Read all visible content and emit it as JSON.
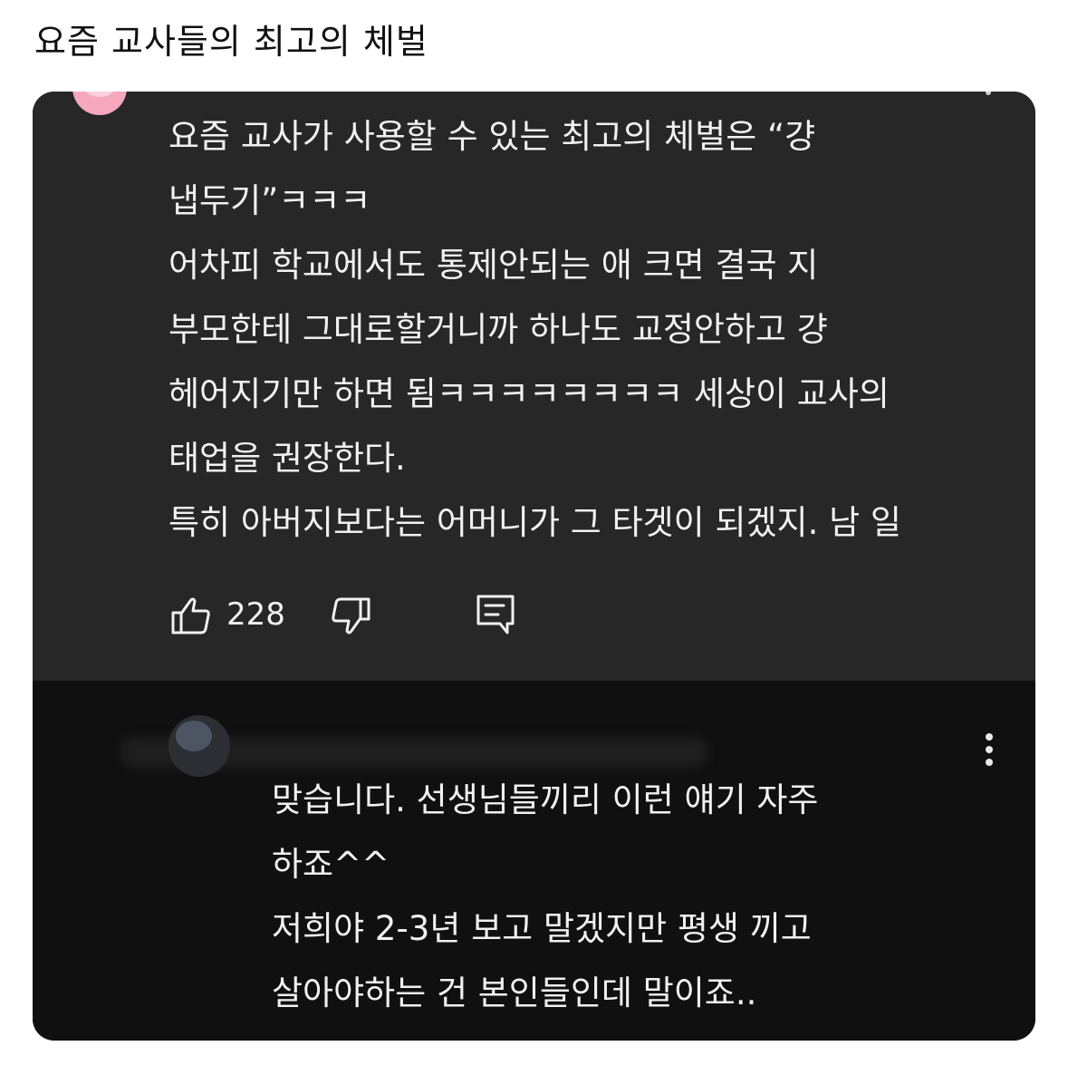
{
  "post": {
    "title": "요즘 교사들의 최고의 체벌"
  },
  "comment": {
    "avatar_icon": "pink-avatar",
    "more_icon": "more-vertical-icon",
    "lines": [
      "요즘 교사가 사용할 수 있는 최고의 체벌은 “걍",
      "냅두기”ㅋㅋㅋ",
      "어차피 학교에서도 통제안되는 애 크면 결국 지",
      "부모한테 그대로할거니까 하나도 교정안하고 걍",
      "헤어지기만 하면 됨ㅋㅋㅋㅋㅋㅋㅋㅋ 세상이 교사의",
      "태업을 권장한다.",
      "특히 아버지보다는 어머니가 그 타겟이 되겠지. 남 일"
    ],
    "like_count": "228",
    "like_icon": "thumbs-up-icon",
    "dislike_icon": "thumbs-down-icon",
    "reply_icon": "reply-comment-icon"
  },
  "reply": {
    "avatar_icon": "user-avatar",
    "username_redacted": true,
    "more_icon": "more-vertical-icon",
    "lines": [
      "맞습니다. 선생님들끼리 이런 얘기 자주",
      "하죠^^",
      "저희야 2-3년 보고 말겠지만 평생 끼고",
      "살아야하는 건 본인들인데 말이죠.."
    ]
  },
  "colors": {
    "page_background": "#ffffff",
    "comment_background": "#272727",
    "reply_background": "#101010",
    "text": "#f1f1f1",
    "title_text": "#111111"
  }
}
